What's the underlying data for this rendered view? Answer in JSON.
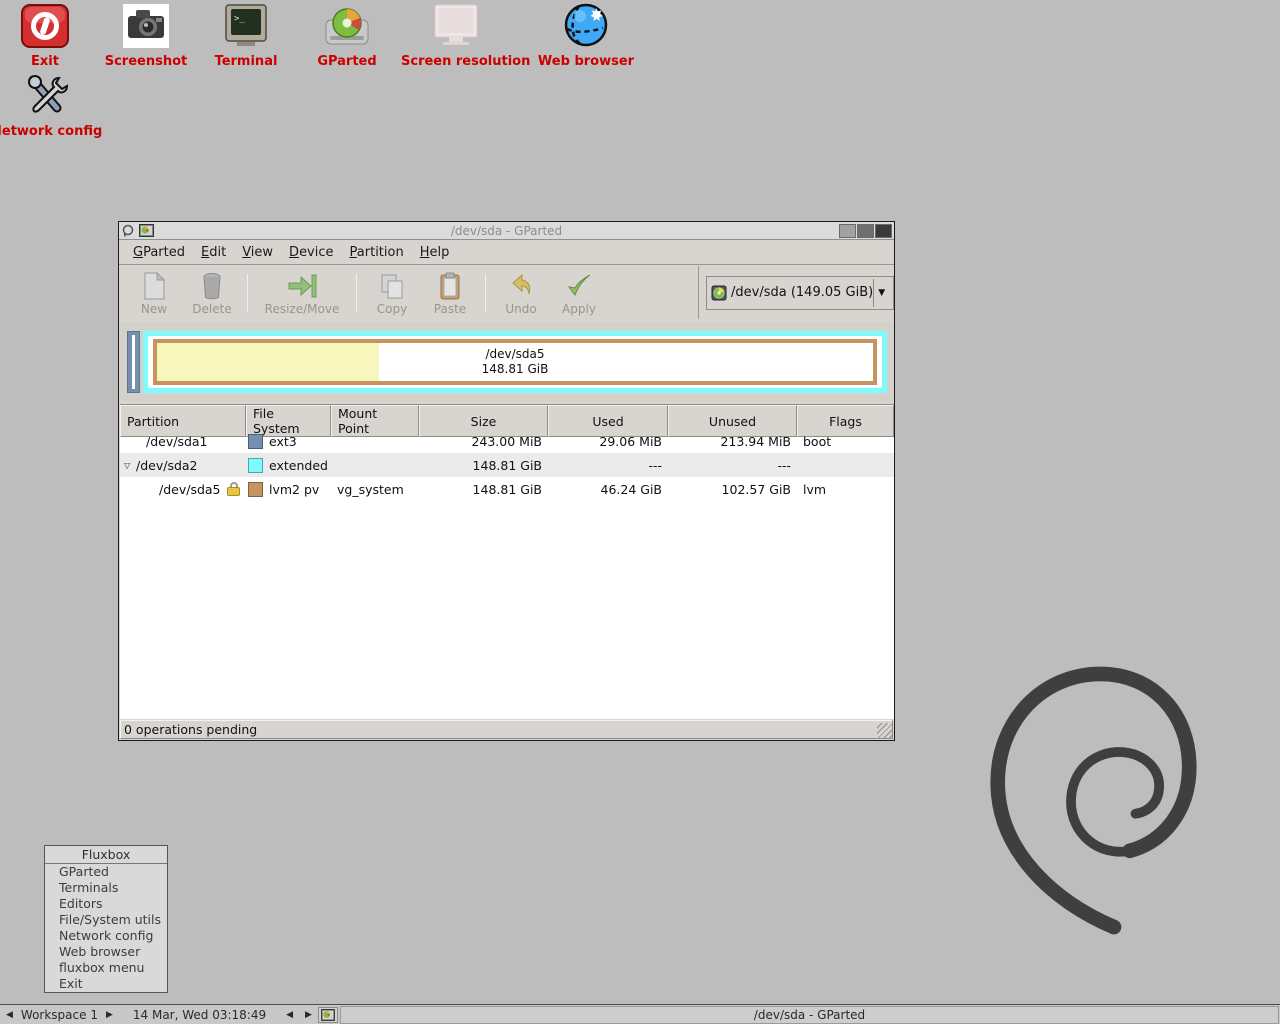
{
  "desktop": {
    "icons": [
      {
        "label": "Exit"
      },
      {
        "label": "Screenshot"
      },
      {
        "label": "Terminal"
      },
      {
        "label": "GParted"
      },
      {
        "label": "Screen resolution"
      },
      {
        "label": "Web browser"
      },
      {
        "label": "Network config"
      }
    ],
    "label_color": "#cc0000"
  },
  "window": {
    "title": "/dev/sda - GParted",
    "menu": {
      "gparted": "GParted",
      "edit": "Edit",
      "view": "View",
      "device": "Device",
      "partition": "Partition",
      "help": "Help"
    },
    "toolbar": {
      "new": "New",
      "delete": "Delete",
      "resize": "Resize/Move",
      "copy": "Copy",
      "paste": "Paste",
      "undo": "Undo",
      "apply": "Apply"
    },
    "device_selector": "/dev/sda  (149.05 GiB)",
    "visual": {
      "partition_label": "/dev/sda5",
      "partition_size": "148.81 GiB",
      "used_percent": "31%",
      "used_fill": "#f6f6bd",
      "extended_border": "#7dfbfd",
      "lvm_border": "#c8945e",
      "ext3_fill": "#7590ae"
    },
    "table": {
      "headers": {
        "partition": "Partition",
        "filesystem": "File System",
        "mount": "Mount Point",
        "size": "Size",
        "used": "Used",
        "unused": "Unused",
        "flags": "Flags"
      },
      "rows": [
        {
          "partition": "/dev/sda1",
          "fs": "ext3",
          "fs_color": "#7590ae",
          "mount": "",
          "size": "243.00 MiB",
          "used": "29.06 MiB",
          "unused": "213.94 MiB",
          "flags": "boot"
        },
        {
          "partition": "/dev/sda2",
          "fs": "extended",
          "fs_color": "#7dfbfd",
          "mount": "",
          "size": "148.81 GiB",
          "used": "---",
          "unused": "---",
          "flags": ""
        },
        {
          "partition": "/dev/sda5",
          "fs": "lvm2 pv",
          "fs_color": "#c8945e",
          "mount": "vg_system",
          "size": "148.81 GiB",
          "used": "46.24 GiB",
          "unused": "102.57 GiB",
          "flags": "lvm"
        }
      ]
    },
    "statusbar": "0 operations pending"
  },
  "fluxbox_menu": {
    "title": "Fluxbox",
    "items": [
      {
        "label": "GParted"
      },
      {
        "label": "Terminals"
      },
      {
        "label": "Editors"
      },
      {
        "label": "File/System utils"
      },
      {
        "label": "Network config"
      },
      {
        "label": "Web browser"
      },
      {
        "label": "fluxbox menu"
      },
      {
        "label": "Exit"
      }
    ]
  },
  "taskbar": {
    "workspace": "Workspace 1",
    "clock": "14 Mar, Wed 03:18:49",
    "window_button": "/dev/sda - GParted"
  }
}
